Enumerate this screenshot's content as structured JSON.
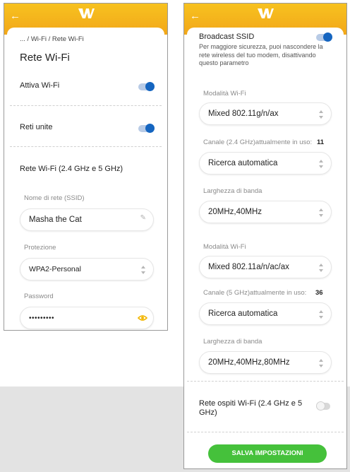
{
  "left": {
    "breadcrumb": "... / Wi-Fi / Rete Wi-Fi",
    "title": "Rete Wi-Fi",
    "wifi_active": {
      "label": "Attiva Wi-Fi",
      "on": true
    },
    "merged_networks": {
      "label": "Reti unite",
      "on": true
    },
    "section_title": "Rete Wi-Fi (2.4 GHz e 5 GHz)",
    "ssid": {
      "label": "Nome di rete (SSID)",
      "value": "Masha the Cat"
    },
    "protection": {
      "label": "Protezione",
      "value": "WPA2-Personal"
    },
    "password": {
      "label": "Password",
      "value": "•••••••••"
    }
  },
  "right": {
    "broadcast": {
      "label": "Broadcast SSID",
      "on": true,
      "description": "Per maggiore sicurezza, puoi nascondere la rete wireless del tuo modem, disattivando questo parametro"
    },
    "band24": {
      "mode_label": "Modalità Wi-Fi",
      "mode_value": "Mixed 802.11g/n/ax",
      "channel_label": "Canale (2.4 GHz)attualmente in uso:",
      "channel_in_use": "11",
      "channel_value": "Ricerca automatica",
      "bandwidth_label": "Larghezza di banda",
      "bandwidth_value": "20MHz,40MHz"
    },
    "band5": {
      "mode_label": "Modalità Wi-Fi",
      "mode_value": "Mixed 802.11a/n/ac/ax",
      "channel_label": "Canale (5 GHz)attualmente in uso:",
      "channel_in_use": "36",
      "channel_value": "Ricerca automatica",
      "bandwidth_label": "Larghezza di banda",
      "bandwidth_value": "20MHz,40MHz,80MHz"
    },
    "guest": {
      "label": "Rete ospiti Wi-Fi (2.4 GHz e 5 GHz)",
      "on": false
    },
    "save_label": "SALVA IMPOSTAZIONI"
  },
  "icons": {
    "back": "arrow-left-icon",
    "logo": "brand-logo-icon",
    "edit": "pencil-icon",
    "eye": "eye-icon",
    "select": "updown-chevron-icon"
  },
  "colors": {
    "appbar": "#f5b41d",
    "toggle_on": "#1565c0",
    "eye": "#f2b705",
    "save": "#45c13b"
  }
}
